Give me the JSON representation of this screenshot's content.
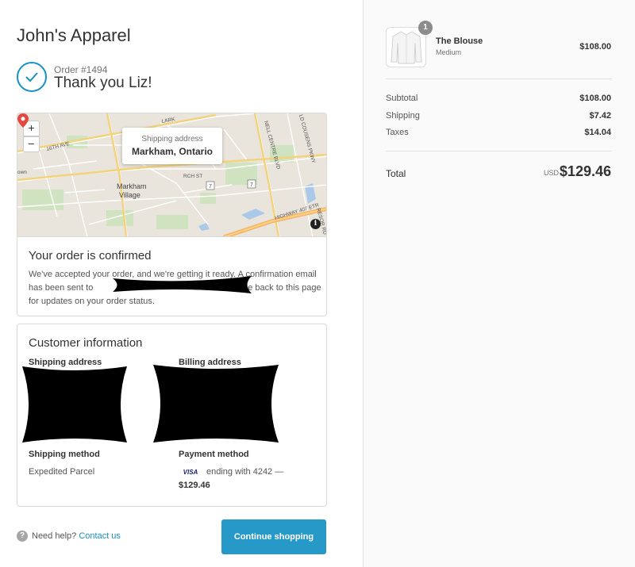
{
  "shop": {
    "name": "John's Apparel"
  },
  "order": {
    "number": "Order #1494",
    "thank_you": "Thank you Liz!"
  },
  "map": {
    "zoom_in": "+",
    "zoom_out": "−",
    "popup_label": "Shipping address",
    "popup_city": "Markham, Ontario",
    "info_icon": "i",
    "street_labels": [
      "16TH AVE",
      "LARK",
      "NELL CENTRE BLVD",
      "LD COUSENS PKWY",
      "RCH ST",
      "Markham",
      "Village",
      "7",
      "7",
      "7",
      "HIGHWAY 407 ETR",
      "RESOR RD",
      "own"
    ]
  },
  "confirmation": {
    "title": "Your order is confirmed",
    "text_part1": "We've accepted your order, and we're getting it ready. A confirmation email has been sent to",
    "text_part2": "come back to this page for updates on your order status."
  },
  "customer_info": {
    "title": "Customer information",
    "shipping_address_heading": "Shipping address",
    "billing_address_heading": "Billing address",
    "shipping_method_heading": "Shipping method",
    "shipping_method_value": "Expedited Parcel",
    "payment_method_heading": "Payment method",
    "card_brand": "VISA",
    "card_ending": "ending with 4242 —",
    "payment_amount": "$129.46"
  },
  "footer": {
    "help_icon": "?",
    "help_text": "Need help?",
    "contact_link": "Contact us",
    "continue_button": "Continue shopping"
  },
  "summary": {
    "item": {
      "name": "The Blouse",
      "variant": "Medium",
      "price": "$108.00",
      "quantity": "1"
    },
    "subtotal_label": "Subtotal",
    "subtotal_value": "$108.00",
    "shipping_label": "Shipping",
    "shipping_value": "$7.42",
    "taxes_label": "Taxes",
    "taxes_value": "$14.04",
    "total_label": "Total",
    "total_currency": "USD",
    "total_value": "$129.46"
  },
  "colors": {
    "accent": "#1990c6",
    "button": "#2699c9",
    "sidebar_bg": "#fafafa",
    "pin": "#e3483f"
  }
}
